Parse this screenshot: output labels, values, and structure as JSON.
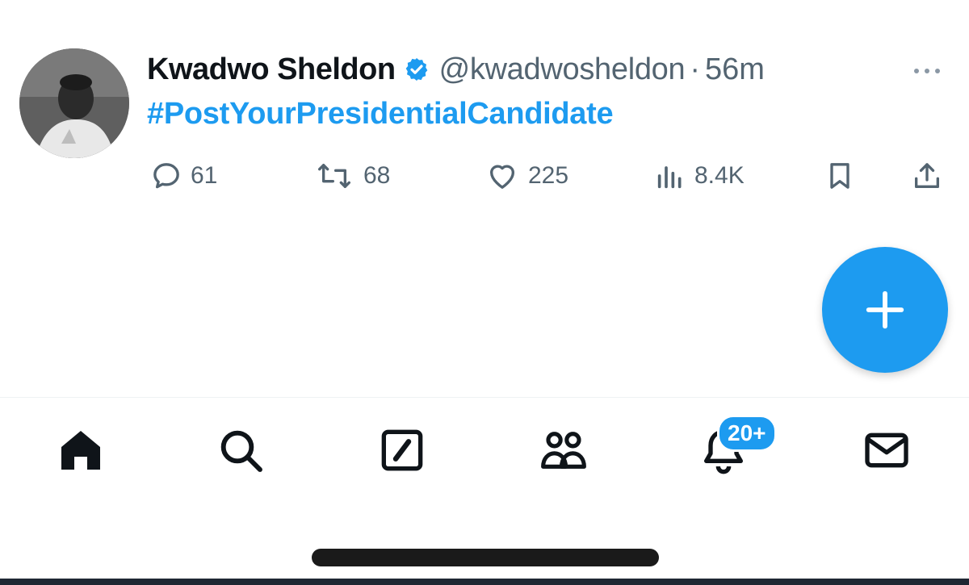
{
  "tweet": {
    "display_name": "Kwadwo Sheldon",
    "handle": "@kwadwosheldon",
    "separator": "·",
    "time": "56m",
    "text": "#PostYourPresidentialCandidate",
    "verified": true
  },
  "actions": {
    "reply_count": "61",
    "retweet_count": "68",
    "like_count": "225",
    "view_count": "8.4K"
  },
  "compose": {
    "icon": "plus-icon"
  },
  "bottom_nav": {
    "items": [
      {
        "icon": "home-icon"
      },
      {
        "icon": "search-icon"
      },
      {
        "icon": "grok-icon"
      },
      {
        "icon": "communities-icon"
      },
      {
        "icon": "notifications-icon",
        "badge": "20+"
      },
      {
        "icon": "messages-icon"
      }
    ]
  },
  "colors": {
    "accent": "#1d9bf0",
    "text_primary": "#0f1419",
    "text_secondary": "#536471"
  }
}
